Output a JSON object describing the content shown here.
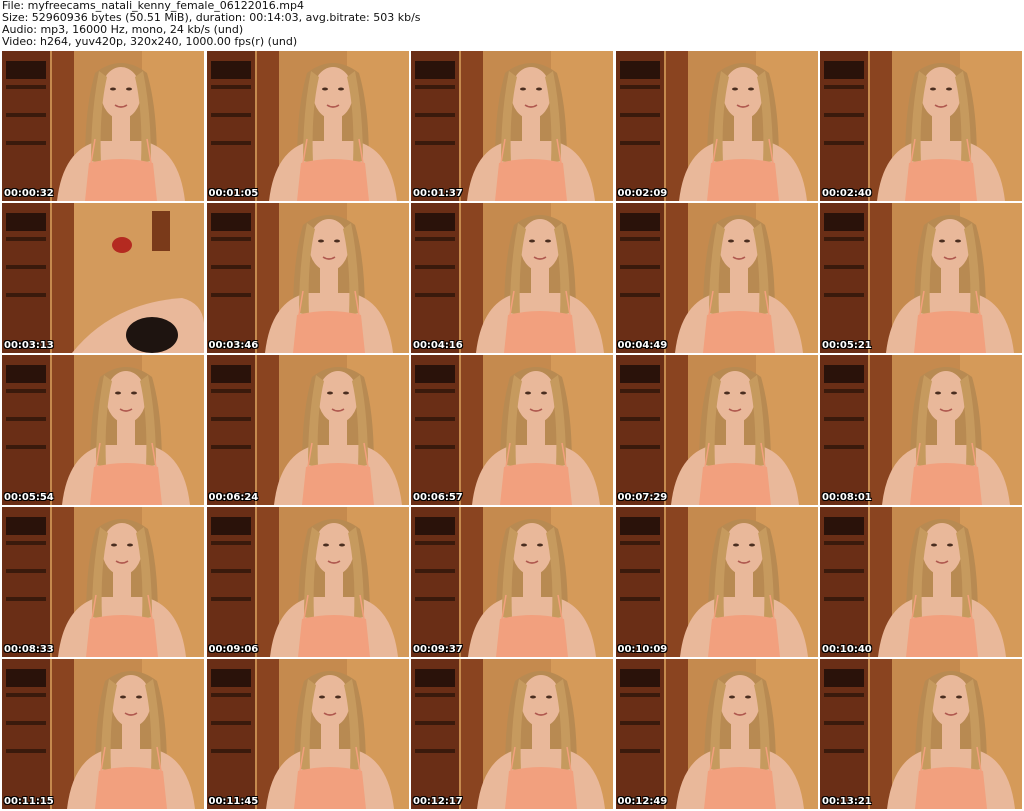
{
  "header": {
    "file_line": "File: myfreecams_natali_kenny_female_06122016.mp4",
    "size_line": "Size: 52960936 bytes (50.51 MiB), duration: 00:14:03, avg.bitrate: 503 kb/s",
    "audio_line": "Audio: mp3, 16000 Hz, mono, 24 kb/s (und)",
    "video_line": "Video: h264, yuv420p, 320x240, 1000.00 fps(r) (und)"
  },
  "thumbnails": [
    {
      "timestamp": "00:00:32"
    },
    {
      "timestamp": "00:01:05"
    },
    {
      "timestamp": "00:01:37"
    },
    {
      "timestamp": "00:02:09"
    },
    {
      "timestamp": "00:02:40"
    },
    {
      "timestamp": "00:03:13"
    },
    {
      "timestamp": "00:03:46"
    },
    {
      "timestamp": "00:04:16"
    },
    {
      "timestamp": "00:04:49"
    },
    {
      "timestamp": "00:05:21"
    },
    {
      "timestamp": "00:05:54"
    },
    {
      "timestamp": "00:06:24"
    },
    {
      "timestamp": "00:06:57"
    },
    {
      "timestamp": "00:07:29"
    },
    {
      "timestamp": "00:08:01"
    },
    {
      "timestamp": "00:08:33"
    },
    {
      "timestamp": "00:09:06"
    },
    {
      "timestamp": "00:09:37"
    },
    {
      "timestamp": "00:10:09"
    },
    {
      "timestamp": "00:10:40"
    },
    {
      "timestamp": "00:11:15"
    },
    {
      "timestamp": "00:11:45"
    },
    {
      "timestamp": "00:12:17"
    },
    {
      "timestamp": "00:12:49"
    },
    {
      "timestamp": "00:13:21"
    }
  ],
  "colors": {
    "wall": "#c58a4e",
    "cabinet": "#6a2e16",
    "hair": "#b88a52",
    "skin": "#e9b89a",
    "top": "#f2a07e",
    "timestamp_text": "#ffffff"
  }
}
